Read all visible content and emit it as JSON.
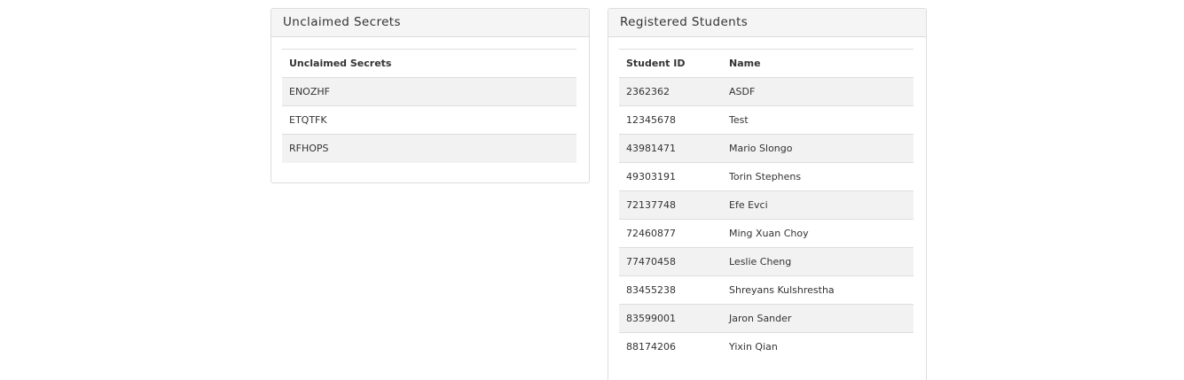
{
  "unclaimed_panel": {
    "title": "Unclaimed Secrets",
    "column_header": "Unclaimed Secrets",
    "rows": [
      "ENOZHF",
      "ETQTFK",
      "RFHOPS"
    ]
  },
  "students_panel": {
    "title": "Registered Students",
    "headers": {
      "student_id": "Student ID",
      "name": "Name"
    },
    "rows": [
      {
        "id": "2362362",
        "name": "ASDF"
      },
      {
        "id": "12345678",
        "name": "Test"
      },
      {
        "id": "43981471",
        "name": "Mario Slongo"
      },
      {
        "id": "49303191",
        "name": "Torin Stephens"
      },
      {
        "id": "72137748",
        "name": "Efe Evci"
      },
      {
        "id": "72460877",
        "name": "Ming Xuan Choy"
      },
      {
        "id": "77470458",
        "name": "Leslie Cheng"
      },
      {
        "id": "83455238",
        "name": "Shreyans Kulshrestha"
      },
      {
        "id": "83599001",
        "name": "Jaron Sander"
      },
      {
        "id": "88174206",
        "name": "Yixin Qian"
      }
    ]
  }
}
